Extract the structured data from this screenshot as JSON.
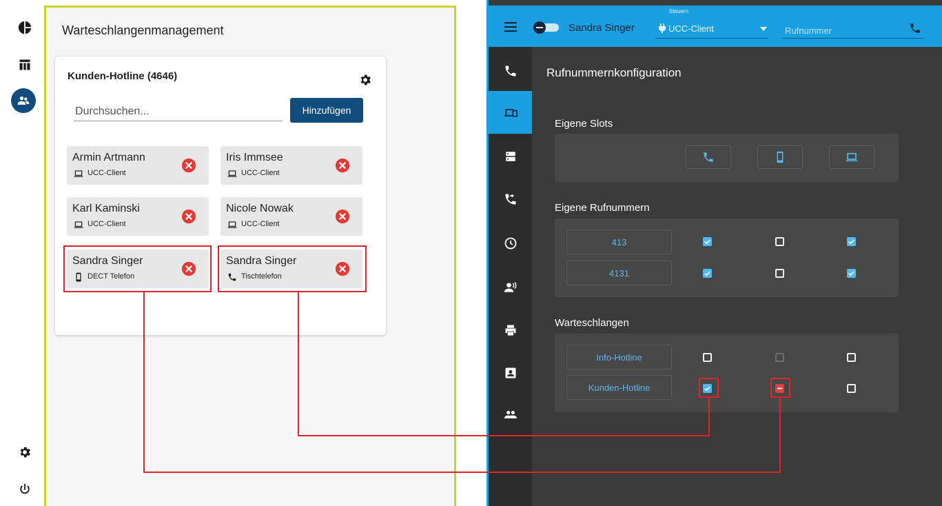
{
  "left": {
    "title": "Warteschlangenmanagement",
    "card": {
      "title": "Kunden-Hotline (4646)",
      "search_placeholder": "Durchsuchen...",
      "add_button": "Hinzufügen",
      "members": [
        {
          "name": "Armin Artmann",
          "device": "UCC-Client",
          "icon": "laptop-icon"
        },
        {
          "name": "Iris Immsee",
          "device": "UCC-Client",
          "icon": "laptop-icon"
        },
        {
          "name": "Karl Kaminski",
          "device": "UCC-Client",
          "icon": "laptop-icon"
        },
        {
          "name": "Nicole Nowak",
          "device": "UCC-Client",
          "icon": "laptop-icon"
        },
        {
          "name": "Sandra Singer",
          "device": "DECT Telefon",
          "icon": "mobile-phone-icon"
        },
        {
          "name": "Sandra Singer",
          "device": "Tischtelefon",
          "icon": "phone-icon"
        }
      ]
    },
    "rail_icons": [
      "pie-chart-icon",
      "table-icon",
      "users-icon",
      "gear-icon",
      "power-icon"
    ]
  },
  "right": {
    "user_name": "Sandra Singer",
    "control_label": "Steuern",
    "device_select": "UCC-Client",
    "number_placeholder": "Rufnummer",
    "content_title": "Rufnummernkonfiguration",
    "sections": {
      "slots": "Eigene Slots",
      "numbers": "Eigene Rufnummern",
      "queues": "Warteschlangen"
    },
    "numbers": [
      {
        "label": "413",
        "states": [
          "checked",
          "unchecked",
          "checked"
        ]
      },
      {
        "label": "4131",
        "states": [
          "checked",
          "unchecked",
          "checked"
        ]
      }
    ],
    "queues": [
      {
        "label": "Info-Hotline",
        "states": [
          "unchecked",
          "disabled",
          "unchecked"
        ]
      },
      {
        "label": "Kunden-Hotline",
        "states": [
          "checked",
          "indeterminate",
          "unchecked"
        ]
      }
    ],
    "slot_icons": [
      "phone-icon",
      "mobile-phone-icon",
      "laptop-icon"
    ],
    "nav_icons": [
      "phone-icon",
      "devices-icon",
      "server-icon",
      "call-forward-icon",
      "clock-icon",
      "voice-icon",
      "printer-icon",
      "contact-card-icon",
      "group-icon"
    ]
  },
  "colors": {
    "accent_blue": "#1aa0e0",
    "navy": "#114d7c",
    "highlight_yellow": "#c6d42b",
    "annotation_red": "#d8262a",
    "remove_red": "#e53935",
    "checkbox_blue": "#54b6ec"
  }
}
